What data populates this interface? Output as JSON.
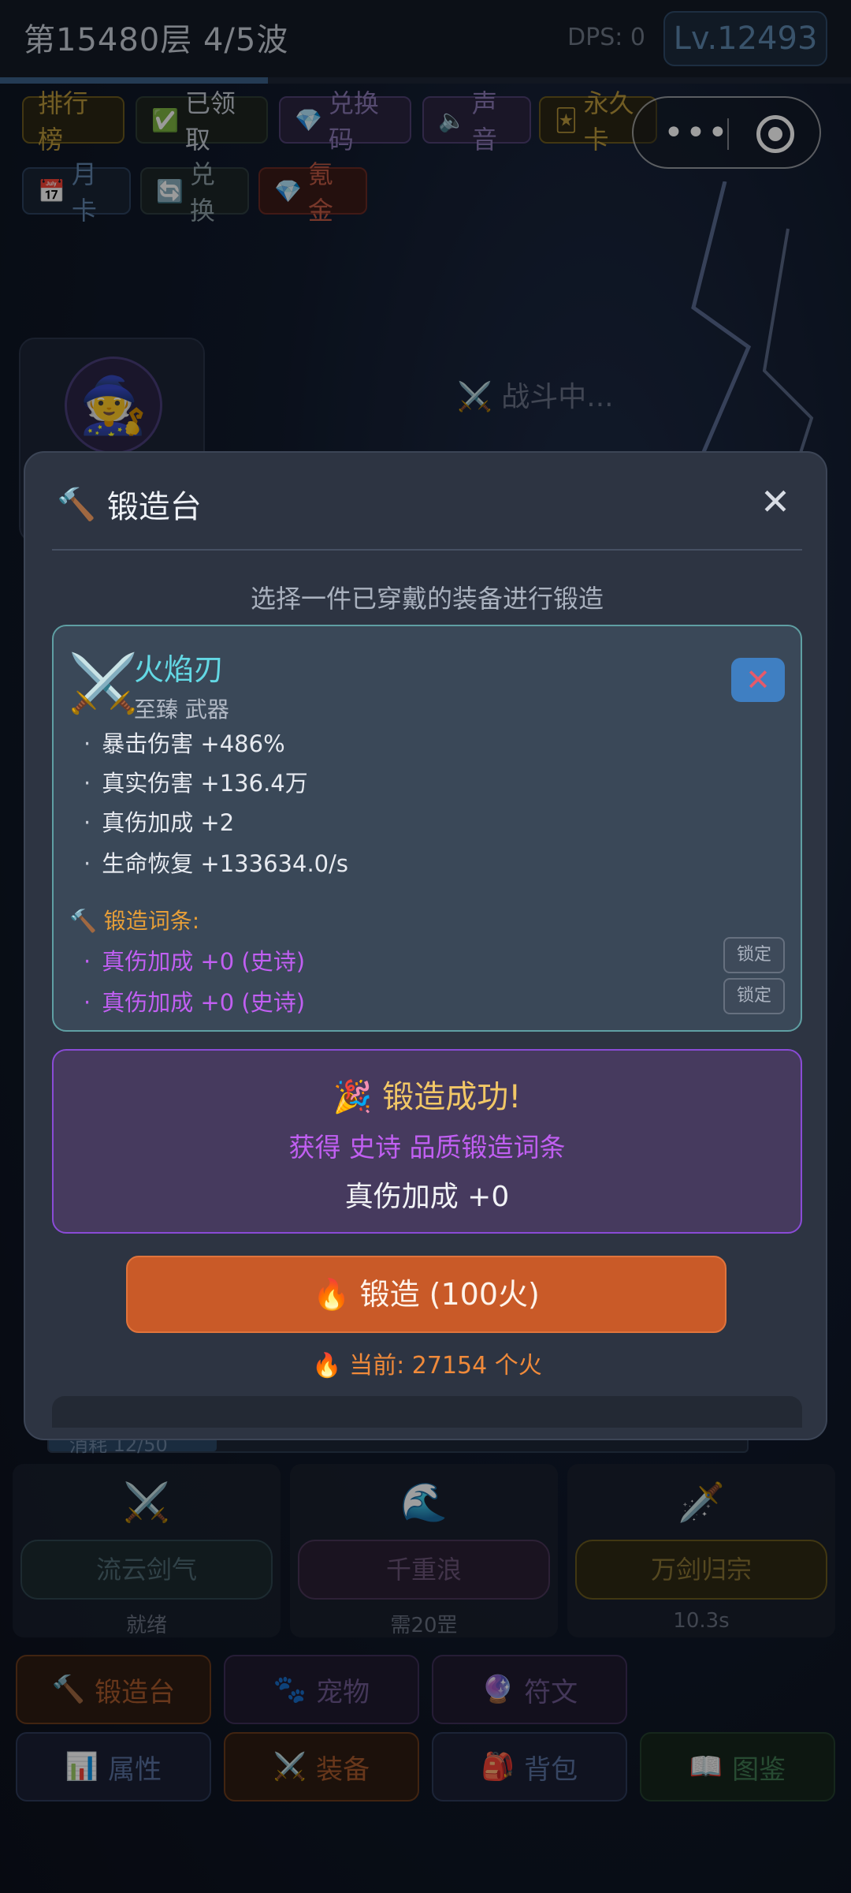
{
  "topbar": {
    "floor": "第15480层 4/5波",
    "dps": "DPS: 0",
    "level": "Lv.12493",
    "progress": 0.315
  },
  "toolbar": {
    "rank": {
      "label": "排行榜"
    },
    "claimed": {
      "icon": "✅",
      "label": "已领取"
    },
    "code": {
      "icon": "💎",
      "label": "兑换码"
    },
    "sound": {
      "icon": "🔈",
      "label": "声音"
    },
    "perm": {
      "icon": "🃏",
      "label": "永久卡"
    },
    "month": {
      "icon": "📅",
      "label": "月卡"
    },
    "exchange": {
      "icon": "🔄",
      "label": "兑换"
    },
    "recharge": {
      "icon": "💎",
      "label": "氪金"
    }
  },
  "scene": {
    "avatar_icon": "🧙",
    "battle": "⚔️ 战斗中..."
  },
  "hp": {
    "text": "消耗 12/50",
    "fill": 0.24
  },
  "skills": [
    {
      "icon": "⚔️",
      "name": "流云剑气",
      "status": "就绪"
    },
    {
      "icon": "🌊",
      "name": "千重浪",
      "status": "需20罡"
    },
    {
      "icon": "🗡️",
      "name": "万剑归宗",
      "status": "10.3s"
    }
  ],
  "nav": [
    {
      "icon": "🔨",
      "label": "锻造台"
    },
    {
      "icon": "🐾",
      "label": "宠物"
    },
    {
      "icon": "🔮",
      "label": "符文"
    },
    {
      "icon": "📊",
      "label": "属性"
    },
    {
      "icon": "⚔️",
      "label": "装备"
    },
    {
      "icon": "🎒",
      "label": "背包"
    },
    {
      "icon": "📖",
      "label": "图鉴"
    }
  ],
  "modal": {
    "icon": "🔨",
    "title": "锻造台",
    "close": "✕",
    "subtitle": "选择一件已穿戴的装备进行锻造",
    "item": {
      "icon": "⚔️",
      "name": "火焰刃",
      "type": "至臻 武器",
      "remove": "✕",
      "stats": [
        "暴击伤害 +486%",
        "真实伤害 +136.4万",
        "真伤加成 +2",
        "生命恢复 +133634.0/s"
      ],
      "forge_label": "锻造词条:",
      "forge_icon": "🔨",
      "affixes": [
        {
          "text": "真伤加成 +0 (史诗)",
          "lock": "锁定"
        },
        {
          "text": "真伤加成 +0 (史诗)",
          "lock": "锁定"
        }
      ]
    },
    "success": {
      "icon": "🎉",
      "title": "锻造成功!",
      "desc": "获得 史诗 品质锻造词条",
      "result": "真伤加成 +0"
    },
    "forge_button": {
      "icon": "🔥",
      "label": "锻造 (100火)"
    },
    "fire": {
      "icon": "🔥",
      "text": "当前: 27154 个火"
    }
  },
  "colors": {
    "accent_cyan": "#63d8e4",
    "epic_purple": "#c15ff2",
    "forge_orange": "#c95a28",
    "gold": "#f2c766"
  }
}
